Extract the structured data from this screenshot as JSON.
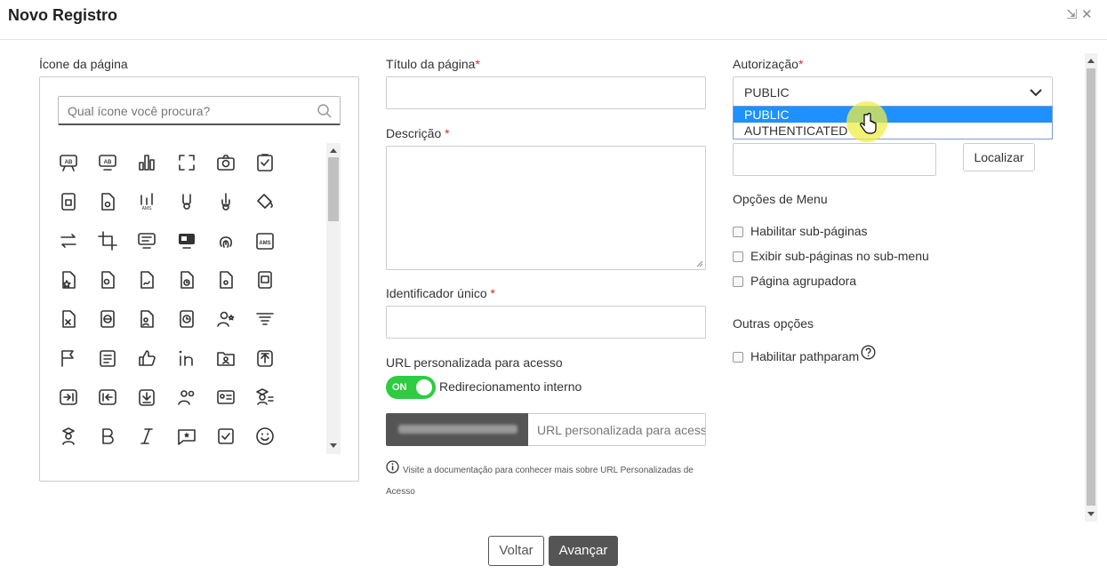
{
  "window": {
    "title": "Novo Registro",
    "restore_glyph": "⇲",
    "close_glyph": "✕"
  },
  "icon_panel": {
    "label": "Ícone da página",
    "search_placeholder": "Qual ícone você procura?",
    "icons": [
      "presentation-ab-icon",
      "monitor-ab-icon",
      "bar-chart-icon",
      "focus-frame-icon",
      "camera-icon",
      "clipboard-check-icon",
      "device-square-icon",
      "file-gear-icon",
      "chart-ams-icon",
      "pitchfork-hand-icon",
      "hook-hand-icon",
      "paint-bucket-icon",
      "swap-arrows-icon",
      "crop-icon",
      "monitor-list-icon",
      "monitor-slides-icon",
      "fingerprint-icon",
      "ams-box-icon",
      "file-star-icon",
      "file-award-icon",
      "file-signature-icon",
      "file-clock-icon",
      "file-gear-2-icon",
      "calendar-box-icon",
      "file-x-icon",
      "file-globe-icon",
      "file-user-icon",
      "clock-box-icon",
      "user-star-icon",
      "filter-lines-icon",
      "flag-icon",
      "document-lines-icon",
      "thumbs-up-icon",
      "linkedin-icon",
      "folder-user-icon",
      "upload-box-icon",
      "arrow-right-bar-icon",
      "arrow-left-bar-icon",
      "download-box-icon",
      "users-icon",
      "id-card-icon",
      "graduate-list-icon",
      "graduate-icon",
      "bold-icon",
      "italic-icon",
      "chat-star-icon",
      "checkbox-icon",
      "smile-icon"
    ]
  },
  "form": {
    "title_label": "Título da página",
    "description_label": "Descrição ",
    "identifier_label": "Identificador único ",
    "required_mark": "*",
    "url_label": "URL personalizada para acesso",
    "toggle_on": "ON",
    "toggle_label": "Redirecionamento interno",
    "url_placeholder": "URL personalizada para acesso",
    "help_text_1": "Visite a documentação para conhecer mais sobre URL Personalizadas de",
    "help_text_2": "Acesso"
  },
  "auth": {
    "label": "Autorização",
    "selected": "PUBLIC",
    "options": [
      "PUBLIC",
      "AUTHENTICATED"
    ],
    "localizar": "Localizar"
  },
  "menu_options": {
    "heading": "Opções de Menu",
    "items": [
      "Habilitar sub-páginas",
      "Exibir sub-páginas no sub-menu",
      "Página agrupadora"
    ]
  },
  "other_options": {
    "heading": "Outras opções",
    "items": [
      "Habilitar pathparam"
    ]
  },
  "footer": {
    "back": "Voltar",
    "next": "Avançar"
  }
}
